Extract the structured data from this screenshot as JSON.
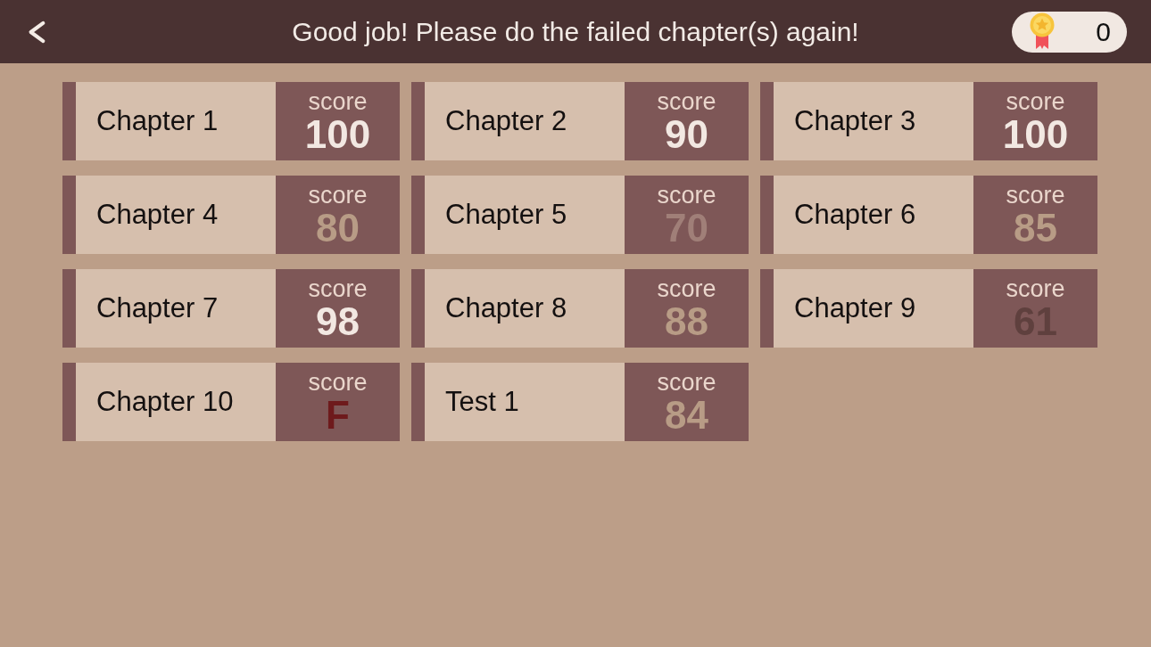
{
  "header": {
    "title": "Good job! Please do the failed chapter(s) again!",
    "coins": "0"
  },
  "chapters": [
    {
      "name": "Chapter 1",
      "score_label": "score",
      "score": "100",
      "color": "#f2e8e2"
    },
    {
      "name": "Chapter 2",
      "score_label": "score",
      "score": "90",
      "color": "#f2e8e2"
    },
    {
      "name": "Chapter 3",
      "score_label": "score",
      "score": "100",
      "color": "#f2e8e2"
    },
    {
      "name": "Chapter 4",
      "score_label": "score",
      "score": "80",
      "color": "#b89c86"
    },
    {
      "name": "Chapter 5",
      "score_label": "score",
      "score": "70",
      "color": "#a07f78"
    },
    {
      "name": "Chapter 6",
      "score_label": "score",
      "score": "85",
      "color": "#b89c86"
    },
    {
      "name": "Chapter 7",
      "score_label": "score",
      "score": "98",
      "color": "#f2e8e2"
    },
    {
      "name": "Chapter 8",
      "score_label": "score",
      "score": "88",
      "color": "#b89c86"
    },
    {
      "name": "Chapter 9",
      "score_label": "score",
      "score": "61",
      "color": "#5f403e"
    },
    {
      "name": "Chapter 10",
      "score_label": "score",
      "score": "F",
      "color": "#6e1a1c"
    },
    {
      "name": "Test 1",
      "score_label": "score",
      "score": "84",
      "color": "#b89c86"
    }
  ]
}
